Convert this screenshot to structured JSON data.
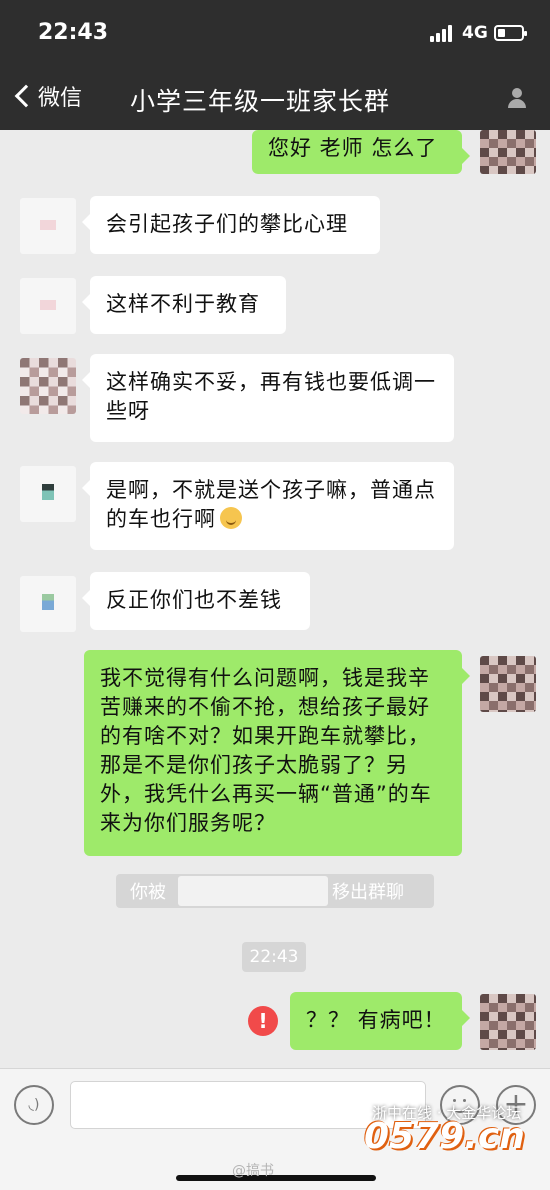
{
  "status_bar": {
    "time": "22:43",
    "network": "4G",
    "battery_level": 0.3
  },
  "nav": {
    "back_label": "微信",
    "title": "小学三年级一班家长群"
  },
  "messages": [
    {
      "side": "right",
      "text": "您好 老师 怎么了"
    },
    {
      "side": "left",
      "text": "会引起孩子们的攀比心理"
    },
    {
      "side": "left",
      "text": "这样不利于教育"
    },
    {
      "side": "left",
      "text": "这样确实不妥，再有钱也要低调一些呀"
    },
    {
      "side": "left",
      "text": "是啊，不就是送个孩子嘛，普通点的车也行啊"
    },
    {
      "side": "left",
      "text": "反正你们也不差钱"
    },
    {
      "side": "right",
      "text": "我不觉得有什么问题啊，钱是我辛苦赚来的不偷不抢，想给孩子最好的有啥不对？如果开跑车就攀比，那是不是你们孩子太脆弱了？另外，我凭什么再买一辆“普通”的车来为你们服务呢？"
    },
    {
      "side": "right",
      "text": "？？ 有病吧！",
      "failed": true
    }
  ],
  "system_note": {
    "prefix": "你被",
    "suffix": "移出群聊"
  },
  "time_label": "22:43",
  "input_bar": {
    "voice_icon": "voice-icon",
    "emoji_icon": "emoji-icon",
    "plus_icon": "plus-icon"
  },
  "watermark": {
    "site_top": "浙中在线 · 大金华论坛",
    "site_big": "0579.cn",
    "weibo": "@搞书"
  },
  "colors": {
    "nav_bg": "#2e2e2e",
    "chat_bg": "#ebebeb",
    "bubble_right": "#9eea6a",
    "bubble_left": "#ffffff",
    "error": "#f14a4a"
  }
}
